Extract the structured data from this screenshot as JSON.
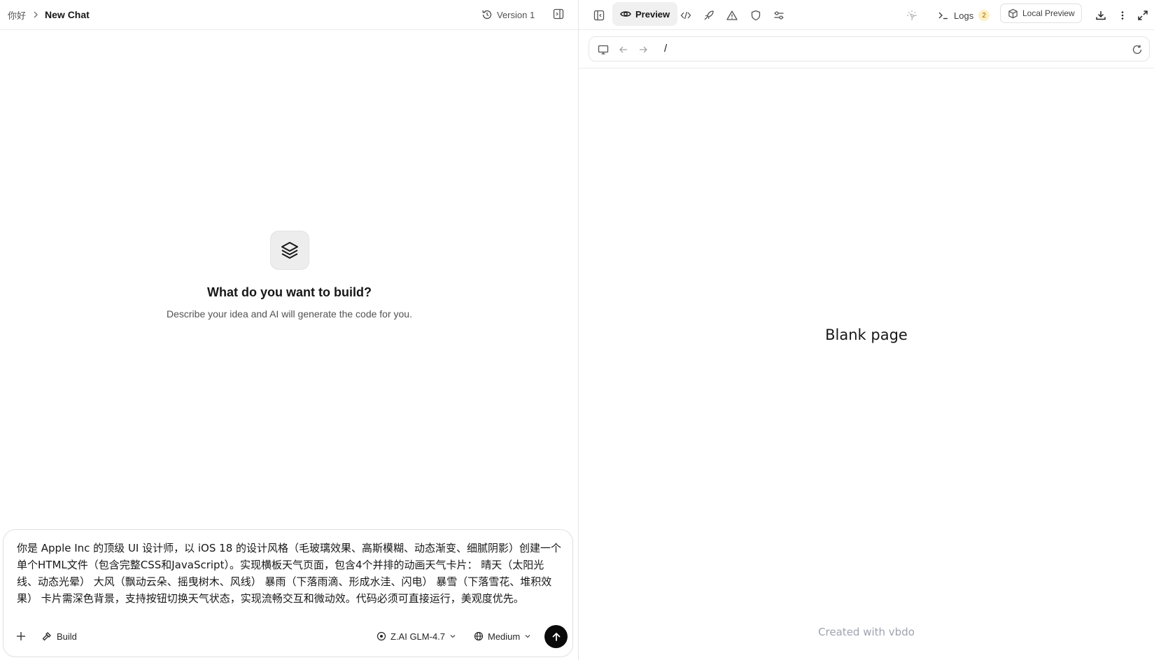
{
  "breadcrumb": {
    "parent": "你好",
    "title": "New Chat"
  },
  "version": {
    "label": "Version 1"
  },
  "hero": {
    "title": "What do you want to build?",
    "subtitle": "Describe your idea and AI will generate the code for you."
  },
  "composer": {
    "prompt": "你是 Apple Inc 的顶级 UI 设计师，以 iOS 18 的设计风格（毛玻璃效果、高斯模糊、动态渐变、细腻阴影）创建一个单个HTML文件（包含完整CSS和JavaScript）。实现横板天气页面，包含4个并排的动画天气卡片： 晴天（太阳光线、动态光晕） 大风（飘动云朵、摇曳树木、风线） 暴雨（下落雨滴、形成水洼、闪电） 暴雪（下落雪花、堆积效果） 卡片需深色背景，支持按钮切换天气状态，实现流畅交互和微动效。代码必须可直接运行，美观度优先。",
    "build_label": "Build",
    "model_label": "Z.AI GLM-4.7",
    "effort_label": "Medium"
  },
  "toolbar": {
    "preview_label": "Preview",
    "logs_label": "Logs",
    "logs_count": "2",
    "local_preview_label": "Local Preview"
  },
  "urlbar": {
    "path": "/"
  },
  "preview": {
    "blank_text": "Blank page",
    "created_text": "Created with vbdo"
  }
}
